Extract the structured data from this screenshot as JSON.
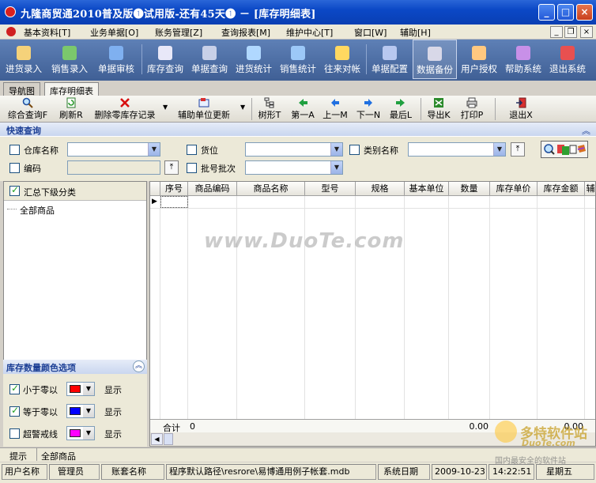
{
  "window": {
    "title": "九隆商贸通2010普及版❶试用版-还有45天❶ － [库存明细表]",
    "min_glyph": "_",
    "max_glyph": "□",
    "close_glyph": "×"
  },
  "menubar": {
    "items": [
      "基本资料[T]",
      "业务单据[O]",
      "账务管理[Z]",
      "查询报表[M]",
      "维护中心[T]",
      "窗口[W]",
      "辅助[H]"
    ],
    "mdi_min": "_",
    "mdi_restore": "❐",
    "mdi_close": "×"
  },
  "main_toolbar": {
    "buttons": [
      {
        "label": "进货录入",
        "icon": "purchase-entry-icon",
        "color": "#f5d27a"
      },
      {
        "label": "销售录入",
        "icon": "sales-entry-icon",
        "color": "#7bc86c"
      },
      {
        "label": "单据审核",
        "icon": "document-check-icon",
        "color": "#7fb0f0"
      },
      {
        "label": "库存查询",
        "icon": "inventory-search-icon",
        "color": "#e8e8f8"
      },
      {
        "label": "单据查询",
        "icon": "document-search-icon",
        "color": "#c8d0e8"
      },
      {
        "label": "进货统计",
        "icon": "purchase-stats-icon",
        "color": "#b0d8ff"
      },
      {
        "label": "销售统计",
        "icon": "sales-stats-icon",
        "color": "#9cc8f8"
      },
      {
        "label": "往来对帐",
        "icon": "reconcile-icon",
        "color": "#ffd860"
      },
      {
        "label": "单据配置",
        "icon": "document-config-icon",
        "color": "#b8c8f0"
      },
      {
        "label": "数据备份",
        "icon": "data-backup-icon",
        "color": "#d8d8e8"
      },
      {
        "label": "用户授权",
        "icon": "user-auth-icon",
        "color": "#ffc880"
      },
      {
        "label": "帮助系统",
        "icon": "help-icon",
        "color": "#c890e8"
      },
      {
        "label": "退出系统",
        "icon": "exit-icon",
        "color": "#e85050"
      }
    ]
  },
  "tabs": [
    {
      "label": "导航图"
    },
    {
      "label": "库存明细表"
    }
  ],
  "sub_toolbar": {
    "buttons": [
      {
        "label": "综合查询F",
        "icon": "magnifier-icon"
      },
      {
        "label": "刷新R",
        "icon": "refresh-icon"
      },
      {
        "label": "删除零库存记录",
        "icon": "delete-icon"
      },
      {
        "label": "辅助单位更新",
        "icon": "unit-update-icon"
      },
      {
        "label": "树形T",
        "icon": "tree-icon"
      },
      {
        "label": "第一A",
        "icon": "first-icon"
      },
      {
        "label": "上一M",
        "icon": "prev-icon"
      },
      {
        "label": "下一N",
        "icon": "next-icon"
      },
      {
        "label": "最后L",
        "icon": "last-icon"
      },
      {
        "label": "导出K",
        "icon": "export-icon"
      },
      {
        "label": "打印P",
        "icon": "print-icon"
      },
      {
        "label": "退出X",
        "icon": "exit-door-icon"
      }
    ]
  },
  "quick_query": {
    "title": "快速查询",
    "collapse_glyph": "︽",
    "fields": {
      "warehouse": {
        "label": "仓库名称",
        "value": ""
      },
      "location": {
        "label": "货位",
        "value": ""
      },
      "category": {
        "label": "类别名称",
        "value": ""
      },
      "code": {
        "label": "编码",
        "value": ""
      },
      "batch": {
        "label": "批号批次",
        "value": ""
      }
    }
  },
  "tree": {
    "summary_label": "汇总下级分类",
    "summary_checked": true,
    "root_label": "全部商品"
  },
  "grid": {
    "columns": [
      "序号",
      "商品编码",
      "商品名称",
      "型号",
      "规格",
      "基本单位",
      "数量",
      "库存单价",
      "库存金额",
      "辅"
    ],
    "footer": {
      "label": "合计",
      "count": "0",
      "quantity": "0.00",
      "amount": "0.00"
    }
  },
  "color_options": {
    "title": "库存数量颜色选项",
    "collapse_glyph": "︽",
    "rows": [
      {
        "label": "小于零以",
        "checked": true,
        "color": "#ff0000",
        "show": "显示"
      },
      {
        "label": "等于零以",
        "checked": true,
        "color": "#0000ff",
        "show": "显示"
      },
      {
        "label": "超警戒线",
        "checked": false,
        "color": "#ff00ff",
        "show": "显示"
      }
    ]
  },
  "hint_bar": {
    "label": "提示",
    "value": "全部商品"
  },
  "status_bar": {
    "user_label": "用户名称",
    "user": "管理员",
    "account_label": "账套名称",
    "path": "程序默认路径\\resrore\\易博通用例子帐套.mdb",
    "date_label": "系统日期",
    "date": "2009-10-23",
    "time": "14:22:51",
    "weekday": "星期五"
  },
  "watermark": "www.DuoTe.com",
  "brand": {
    "name": "多特软件站",
    "site": "DuoTe.com",
    "slogan": "国内最安全的软件站"
  }
}
